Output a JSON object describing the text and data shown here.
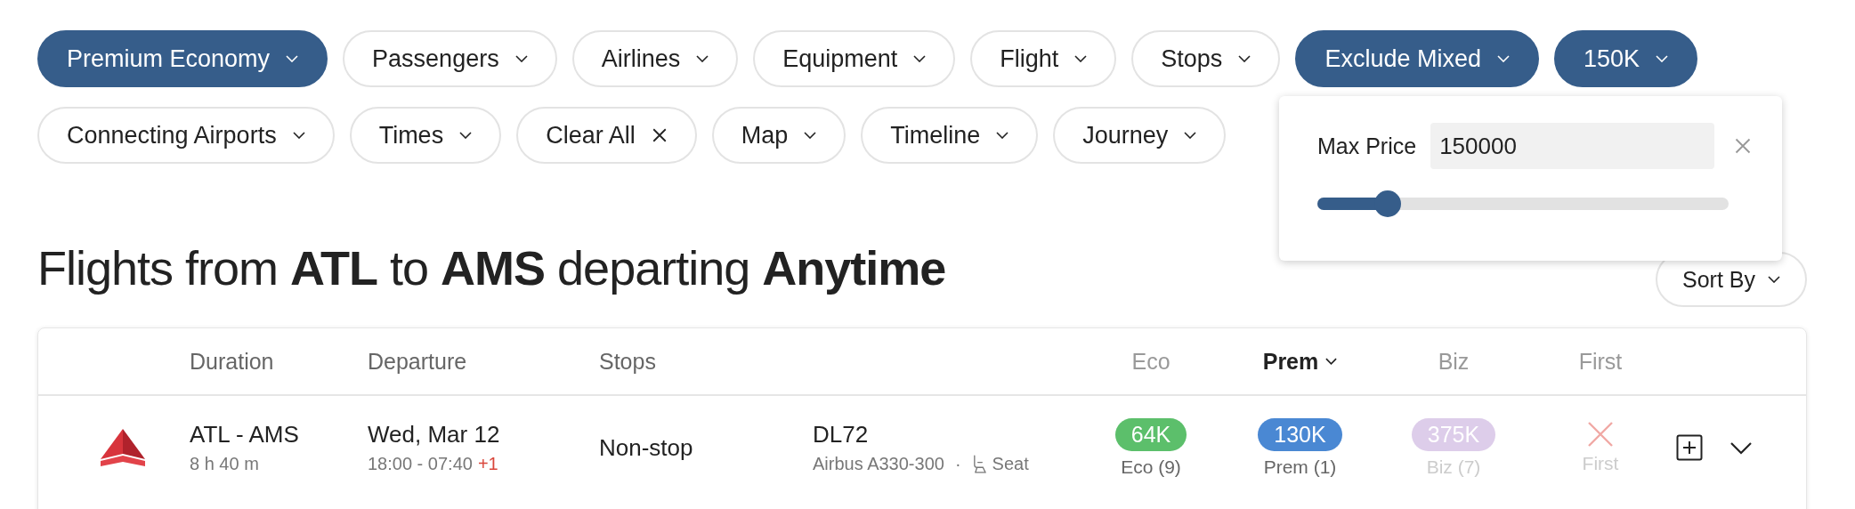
{
  "filters": [
    [
      {
        "label": "Premium Economy",
        "kind": "dropdown",
        "selected": true
      },
      {
        "label": "Passengers",
        "kind": "dropdown",
        "selected": false
      },
      {
        "label": "Airlines",
        "kind": "dropdown",
        "selected": false
      },
      {
        "label": "Equipment",
        "kind": "dropdown",
        "selected": false
      },
      {
        "label": "Flight",
        "kind": "dropdown",
        "selected": false
      },
      {
        "label": "Stops",
        "kind": "dropdown",
        "selected": false
      },
      {
        "label": "Exclude Mixed",
        "kind": "dropdown",
        "selected": true
      },
      {
        "label": "150K",
        "kind": "dropdown",
        "selected": true
      }
    ],
    [
      {
        "label": "Connecting Airports",
        "kind": "dropdown",
        "selected": false
      },
      {
        "label": "Times",
        "kind": "dropdown",
        "selected": false
      },
      {
        "label": "Clear All",
        "kind": "clear",
        "selected": false
      },
      {
        "label": "Map",
        "kind": "dropdown",
        "selected": false
      },
      {
        "label": "Timeline",
        "kind": "dropdown",
        "selected": false
      },
      {
        "label": "Journey",
        "kind": "dropdown",
        "selected": false
      }
    ]
  ],
  "price_popup": {
    "label": "Max Price",
    "value": "150000",
    "level": 0.17
  },
  "heading": "Flights from **ATL** to **AMS** departing **Anytime**",
  "sort_button": "Sort By",
  "table": {
    "columns": [
      {
        "label": "Duration"
      },
      {
        "label": "Departure"
      },
      {
        "label": "Stops"
      }
    ],
    "cabin_columns": [
      {
        "label": "Eco",
        "selected": false
      },
      {
        "label": "Prem",
        "selected": true
      },
      {
        "label": "Biz",
        "selected": false
      },
      {
        "label": "First",
        "selected": false
      }
    ],
    "rows": [
      {
        "route": "ATL - AMS",
        "duration": "8 h 40 m",
        "date": "Wed, Mar 12",
        "times": "18:00 - 07:40",
        "day_offset": "+1",
        "stops": "Non-stop",
        "flight": "DL72",
        "aircraft": "Airbus A330-300",
        "separator": "·",
        "seat": "Seat",
        "fares": [
          {
            "kind": "price",
            "price": "64K",
            "label": "Eco (9)",
            "color": "#5cbf6b",
            "faded": false
          },
          {
            "kind": "price",
            "price": "130K",
            "label": "Prem (1)",
            "color": "#4a88d3",
            "faded": false
          },
          {
            "kind": "price",
            "price": "375K",
            "label": "Biz (7)",
            "color": "#ddcdea",
            "faded": true
          },
          {
            "kind": "unavailable",
            "label": "First",
            "faded": true
          }
        ]
      }
    ]
  }
}
